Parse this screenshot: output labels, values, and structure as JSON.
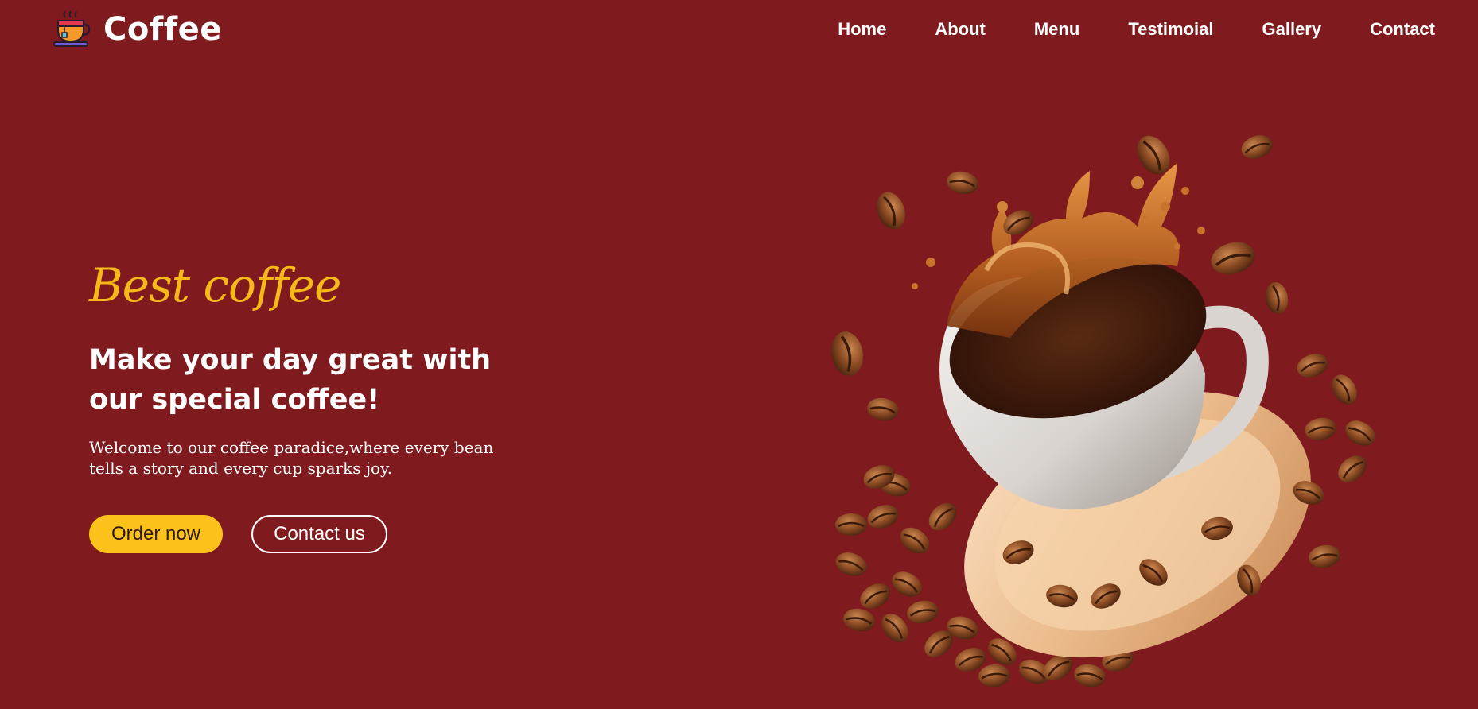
{
  "header": {
    "brand": "Coffee",
    "logo_icon": "coffee-cup-icon",
    "nav": [
      {
        "label": "Home"
      },
      {
        "label": "About"
      },
      {
        "label": "Menu"
      },
      {
        "label": "Testimoial"
      },
      {
        "label": "Gallery"
      },
      {
        "label": "Contact"
      }
    ]
  },
  "hero": {
    "tagline": "Best coffee",
    "title": "Make your day great with our special coffee!",
    "description": "Welcome to our coffee paradice,where every bean tells a story and every cup sparks joy.",
    "primary_button": "Order now",
    "secondary_button": "Contact us",
    "image_icon": "coffee-splash-illustration"
  },
  "colors": {
    "background": "#7f1b1e",
    "accent": "#fcc21b",
    "tagline": "#f7b81a",
    "text": "#ffffff"
  }
}
